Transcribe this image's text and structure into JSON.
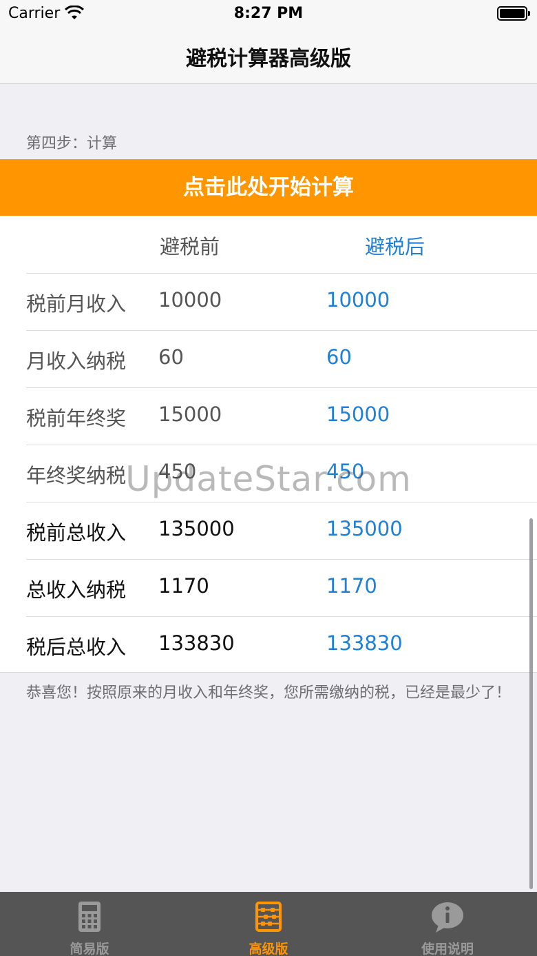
{
  "status_bar": {
    "carrier": "Carrier",
    "time": "8:27 PM"
  },
  "nav": {
    "title": "避税计算器高级版"
  },
  "step": {
    "label": "第四步：计算"
  },
  "calc_button": {
    "label": "点击此处开始计算"
  },
  "table": {
    "headers": {
      "before": "避税前",
      "after": "避税后"
    },
    "rows": [
      {
        "label": "税前月收入",
        "before": "10000",
        "after": "10000"
      },
      {
        "label": "月收入纳税",
        "before": "60",
        "after": "60"
      },
      {
        "label": "税前年终奖",
        "before": "15000",
        "after": "15000"
      },
      {
        "label": "年终奖纳税",
        "before": "450",
        "after": "450"
      },
      {
        "label": "税前总收入",
        "before": "135000",
        "after": "135000"
      },
      {
        "label": "总收入纳税",
        "before": "1170",
        "after": "1170"
      },
      {
        "label": "税后总收入",
        "before": "133830",
        "after": "133830"
      }
    ]
  },
  "result": {
    "message": "恭喜您！按照原来的月收入和年终奖，您所需缴纳的税，已经是最少了！"
  },
  "watermark": "UpdateStar.com",
  "tab_bar": {
    "tabs": [
      {
        "label": "简易版",
        "icon": "calculator-icon",
        "active": false
      },
      {
        "label": "高级版",
        "icon": "abacus-icon",
        "active": true
      },
      {
        "label": "使用说明",
        "icon": "info-bubble-icon",
        "active": false
      }
    ]
  },
  "colors": {
    "accent": "#ff9500",
    "after_value": "#1e80d8",
    "tab_bar": "#555555"
  }
}
